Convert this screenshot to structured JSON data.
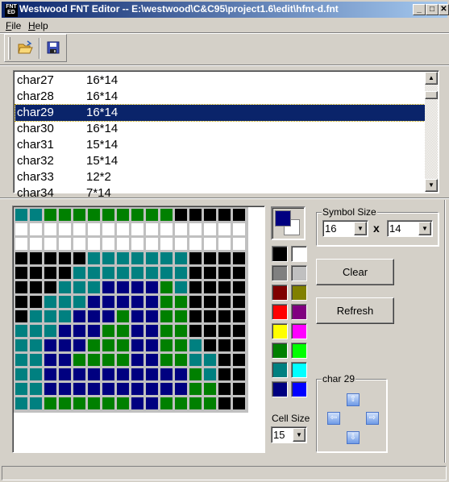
{
  "window": {
    "title": "Westwood FNT Editor  --  E:\\westwood\\C&C95\\project1.6\\edit\\hfnt-d.fnt",
    "icon_text": "FNT ED",
    "minimize": "_",
    "maximize": "□",
    "close": "✕"
  },
  "menu": [
    {
      "label": "File",
      "accel": "F",
      "rest": "ile"
    },
    {
      "label": "Help",
      "accel": "H",
      "rest": "elp"
    }
  ],
  "toolbar": {
    "open_icon": "open-folder-icon",
    "save_icon": "floppy-disk-icon"
  },
  "char_list": {
    "selected_index": 2,
    "items": [
      {
        "name": "char27",
        "size": "16*14"
      },
      {
        "name": "char28",
        "size": "16*14"
      },
      {
        "name": "char29",
        "size": "16*14"
      },
      {
        "name": "char30",
        "size": "16*14"
      },
      {
        "name": "char31",
        "size": "15*14"
      },
      {
        "name": "char32",
        "size": "15*14"
      },
      {
        "name": "char33",
        "size": "12*2"
      },
      {
        "name": "char34",
        "size": "7*14"
      }
    ]
  },
  "editor": {
    "colors": {
      "T": "#008080",
      "G": "#008000",
      "K": "#000000",
      "W": "#ffffff",
      "B": "#000080"
    },
    "pixels": [
      "TTGGGGGGGGGKKKKK",
      "WWWWWWWWWWWWWWWW",
      "WWWWWWWWWWWWWWWW",
      "KKKKKTTTTTTTKKKK",
      "KKKKTTTTTTTTKKKK",
      "KKKTTTBBBBGTKKKK",
      "KKTTTBBBBBGGKKKK",
      "KTTTBBBGBBGGKKKK",
      "TTTBBBGGBBGGKKKK",
      "TTBBBGGGBBGGTKKK",
      "TTBBGGGGBBGGTTKK",
      "TTBBBBBBBBBBGTKK",
      "TTBBBBBBBBBBGGKK",
      "TTGGGGGGBBGGGGKK"
    ]
  },
  "current_color": {
    "foreground": "#000080",
    "background": "#ffffff"
  },
  "palette": [
    "#000000",
    "#ffffff",
    "#808080",
    "#c0c0c0",
    "#800000",
    "#808000",
    "#ff0000",
    "#800080",
    "#ffff00",
    "#ff00ff",
    "#008000",
    "#00ff00",
    "#008080",
    "#00ffff",
    "#000080",
    "#0000ff"
  ],
  "cell_size": {
    "label": "Cell Size",
    "value": "15"
  },
  "symbol_size": {
    "label": "Symbol Size",
    "width": "16",
    "times": "x",
    "height": "14"
  },
  "buttons": {
    "clear": "Clear",
    "refresh": "Refresh"
  },
  "shift_group": {
    "label": "char 29",
    "up": "⇧",
    "left": "⇦",
    "right": "⇨",
    "down": "⇩"
  }
}
